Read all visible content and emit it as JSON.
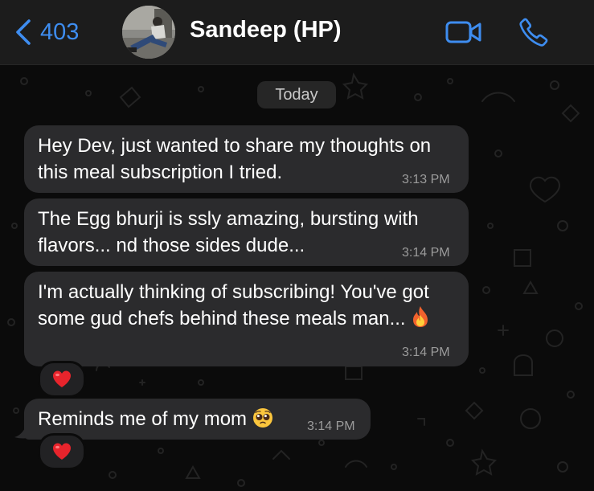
{
  "header": {
    "back_count": "403",
    "contact_name": "Sandeep (HP)",
    "icons": {
      "back": "chevron-left-icon",
      "video": "video-call-icon",
      "phone": "phone-icon"
    },
    "accent_color": "#3e8df0"
  },
  "chat": {
    "date_label": "Today",
    "messages": [
      {
        "text": "Hey Dev, just wanted to share my thoughts on this meal subscription I tried.",
        "time": "3:13 PM"
      },
      {
        "text": "The Egg bhurji is ssly amazing, bursting with flavors... nd those sides dude...",
        "time": "3:14 PM"
      },
      {
        "text": "I'm actually thinking of subscribing! You've got some gud chefs behind these meals man...",
        "time": "3:14 PM",
        "emoji": "fire-emoji",
        "reaction": "red-heart-emoji"
      },
      {
        "text": "Reminds me of my mom",
        "time": "3:14 PM",
        "emoji": "pleading-face-emoji",
        "reaction": "red-heart-emoji"
      }
    ],
    "bubble_color": "#2b2b2d",
    "wallpaper_color": "#0b0b0b"
  }
}
